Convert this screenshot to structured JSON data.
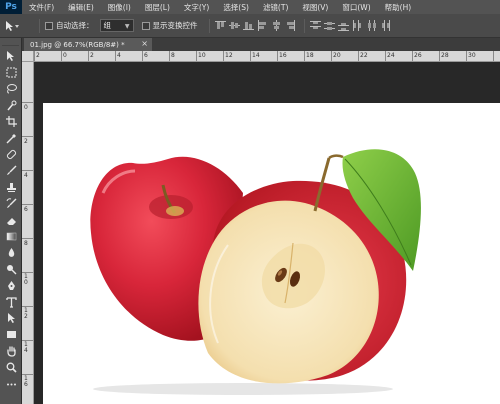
{
  "app": {
    "logo": "Ps"
  },
  "menu": [
    "文件(F)",
    "编辑(E)",
    "图像(I)",
    "图层(L)",
    "文字(Y)",
    "选择(S)",
    "滤镜(T)",
    "视图(V)",
    "窗口(W)",
    "帮助(H)"
  ],
  "options": {
    "auto_select_label": "自动选择：",
    "auto_select_value": "组",
    "show_transform_label": "显示变换控件"
  },
  "document": {
    "tab_title": "01.jpg @ 66.7%(RGB/8#) *",
    "close_glyph": "×"
  },
  "ruler": {
    "top_numbers": [
      "2",
      "0",
      "2",
      "4",
      "6",
      "8",
      "10",
      "12",
      "14",
      "16",
      "18",
      "20",
      "22",
      "24",
      "26",
      "28",
      "30"
    ],
    "left_numbers": [
      "0",
      "2",
      "4",
      "6",
      "8",
      "1 0",
      "1 2",
      "1 4",
      "1 6",
      "1 8"
    ]
  },
  "colors": {
    "apple_red": "#d8263a",
    "apple_flesh": "#f6e3b6",
    "leaf_green": "#6fb53a",
    "stem_brown": "#8a6a2e"
  }
}
